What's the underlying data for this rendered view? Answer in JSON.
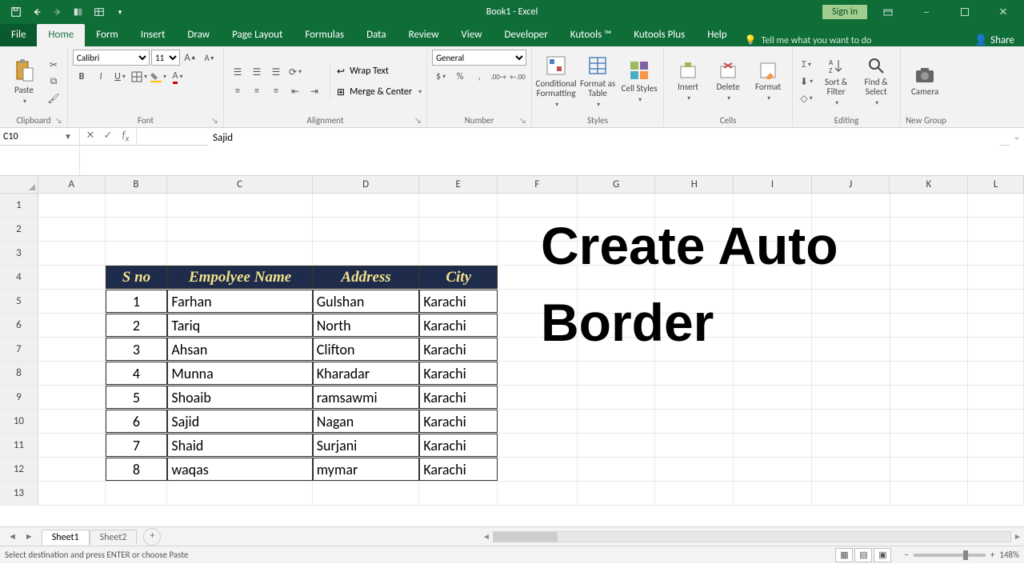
{
  "title": "Book1 - Excel",
  "signin": "Sign in",
  "tabs": {
    "file": "File",
    "home": "Home",
    "form": "Form",
    "insert": "Insert",
    "draw": "Draw",
    "pagelayout": "Page Layout",
    "formulas": "Formulas",
    "data": "Data",
    "review": "Review",
    "view": "View",
    "developer": "Developer",
    "kutools": "Kutools ™",
    "kutoolsplus": "Kutools Plus",
    "help": "Help"
  },
  "tell": "Tell me what you want to do",
  "share": "Share",
  "ribbon": {
    "clipboard": {
      "paste": "Paste",
      "label": "Clipboard"
    },
    "font": {
      "name": "Calibri",
      "size": "11",
      "label": "Font"
    },
    "alignment": {
      "wrap": "Wrap Text",
      "merge": "Merge & Center",
      "label": "Alignment"
    },
    "number": {
      "format": "General",
      "label": "Number"
    },
    "styles": {
      "cond": "Conditional Formatting",
      "fmt": "Format as Table",
      "cell": "Cell Styles",
      "label": "Styles"
    },
    "cells": {
      "insert": "Insert",
      "delete": "Delete",
      "format": "Format",
      "label": "Cells"
    },
    "editing": {
      "sort": "Sort & Filter",
      "find": "Find & Select",
      "label": "Editing"
    },
    "newgroup": {
      "camera": "Camera",
      "label": "New Group"
    }
  },
  "namebox": "C10",
  "formula": "Sajid",
  "columns": [
    "A",
    "B",
    "C",
    "D",
    "E",
    "F",
    "G",
    "H",
    "I",
    "J",
    "K",
    "L"
  ],
  "rowcount": 13,
  "table": {
    "headers": [
      "S no",
      "Empolyee Name",
      "Address",
      "City"
    ],
    "rows": [
      [
        "1",
        "Farhan",
        "Gulshan",
        "Karachi"
      ],
      [
        "2",
        "Tariq",
        "North",
        "Karachi"
      ],
      [
        "3",
        "Ahsan",
        "Clifton",
        "Karachi"
      ],
      [
        "4",
        "Munna",
        "Kharadar",
        "Karachi"
      ],
      [
        "5",
        "Shoaib",
        "ramsawmi",
        "Karachi"
      ],
      [
        "6",
        "Sajid",
        "Nagan",
        "Karachi"
      ],
      [
        "7",
        "Shaid",
        "Surjani",
        "Karachi"
      ],
      [
        "8",
        "waqas",
        "mymar",
        "Karachi"
      ]
    ]
  },
  "overlay": "Create Auto\nBorder",
  "sheets": {
    "s1": "Sheet1",
    "s2": "Sheet2"
  },
  "status": "Select destination and press ENTER or choose Paste",
  "zoom": "148%"
}
